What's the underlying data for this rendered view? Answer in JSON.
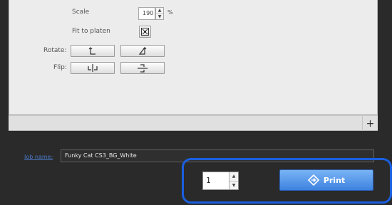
{
  "layout": {
    "scale_label": "Scale",
    "scale_value": "190",
    "scale_unit": "%",
    "fit_to_platen_label": "Fit to platen",
    "rotate_label": "Rotate:",
    "flip_label": "Flip:"
  },
  "layers": {
    "add_label": "+"
  },
  "job": {
    "name_label": "Job name:",
    "name_value": "Funky Cat CS3_BG_White"
  },
  "print": {
    "copies": "1",
    "button_label": "Print"
  },
  "colors": {
    "highlight": "#1a5fe0",
    "print_button": "#3d82e0"
  }
}
